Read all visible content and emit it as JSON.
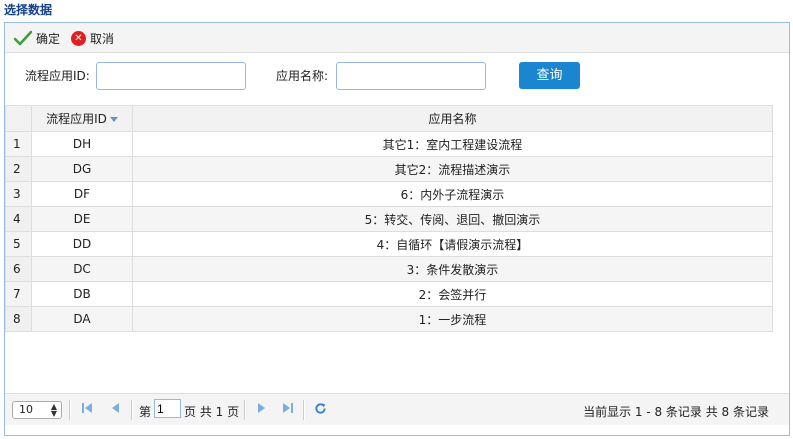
{
  "title": "选择数据",
  "toolbar": {
    "ok_label": "确定",
    "cancel_label": "取消"
  },
  "search": {
    "id_label": "流程应用ID:",
    "id_value": "",
    "name_label": "应用名称:",
    "name_value": "",
    "query_label": "查询"
  },
  "grid": {
    "columns": [
      "流程应用ID",
      "应用名称"
    ],
    "rows": [
      {
        "n": "1",
        "id": "DH",
        "name": "其它1：室内工程建设流程"
      },
      {
        "n": "2",
        "id": "DG",
        "name": "其它2：流程描述演示"
      },
      {
        "n": "3",
        "id": "DF",
        "name": "6：内外子流程演示"
      },
      {
        "n": "4",
        "id": "DE",
        "name": "5：转交、传阅、退回、撤回演示"
      },
      {
        "n": "5",
        "id": "DD",
        "name": "4：自循环【请假演示流程】"
      },
      {
        "n": "6",
        "id": "DC",
        "name": "3：条件发散演示"
      },
      {
        "n": "7",
        "id": "DB",
        "name": "2：会签并行"
      },
      {
        "n": "8",
        "id": "DA",
        "name": "1：一步流程"
      }
    ]
  },
  "pager": {
    "page_size": "10",
    "page_prefix": "第",
    "page_value": "1",
    "page_suffix": "页 共 1 页",
    "info": "当前显示 1 - 8 条记录 共 8 条记录"
  },
  "colors": {
    "accent": "#1a86d0",
    "title": "#15428b",
    "border": "#99bbe8",
    "pager_icon": "#7aaee0",
    "cancel": "#e02020",
    "ok_check": "#3aa03a"
  }
}
